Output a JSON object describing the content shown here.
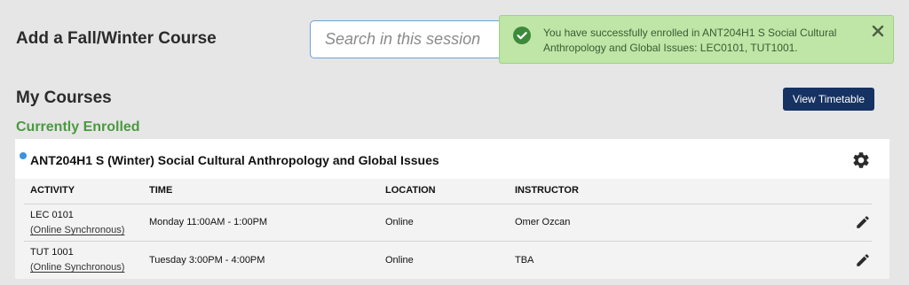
{
  "header": {
    "title": "Add a Fall/Winter Course",
    "search_placeholder": "Search in this session"
  },
  "notification": {
    "message": "You have successfully enrolled in ANT204H1 S Social Cultural Anthropology and Global Issues: LEC0101, TUT1001.",
    "type": "success",
    "icons": {
      "status": "check-circle-icon",
      "close": "close-icon"
    }
  },
  "my_courses": {
    "title": "My Courses",
    "view_timetable_label": "View Timetable",
    "enrolled_label": "Currently Enrolled"
  },
  "course": {
    "title": "ANT204H1 S (Winter) Social Cultural Anthropology and Global Issues",
    "columns": [
      "ACTIVITY",
      "TIME",
      "LOCATION",
      "INSTRUCTOR"
    ],
    "rows": [
      {
        "activity": "LEC 0101",
        "delivery": "(Online Synchronous)",
        "time": "Monday 11:00AM - 1:00PM",
        "location": "Online",
        "instructor": "Omer Ozcan"
      },
      {
        "activity": "TUT 1001",
        "delivery": "(Online Synchronous)",
        "time": "Tuesday 3:00PM - 4:00PM",
        "location": "Online",
        "instructor": "TBA"
      }
    ]
  },
  "colors": {
    "accent_blue": "#163262",
    "enrolled_green": "#4a9a3f",
    "toast_bg": "#bfe6a6",
    "dot_blue": "#3a93e0"
  }
}
